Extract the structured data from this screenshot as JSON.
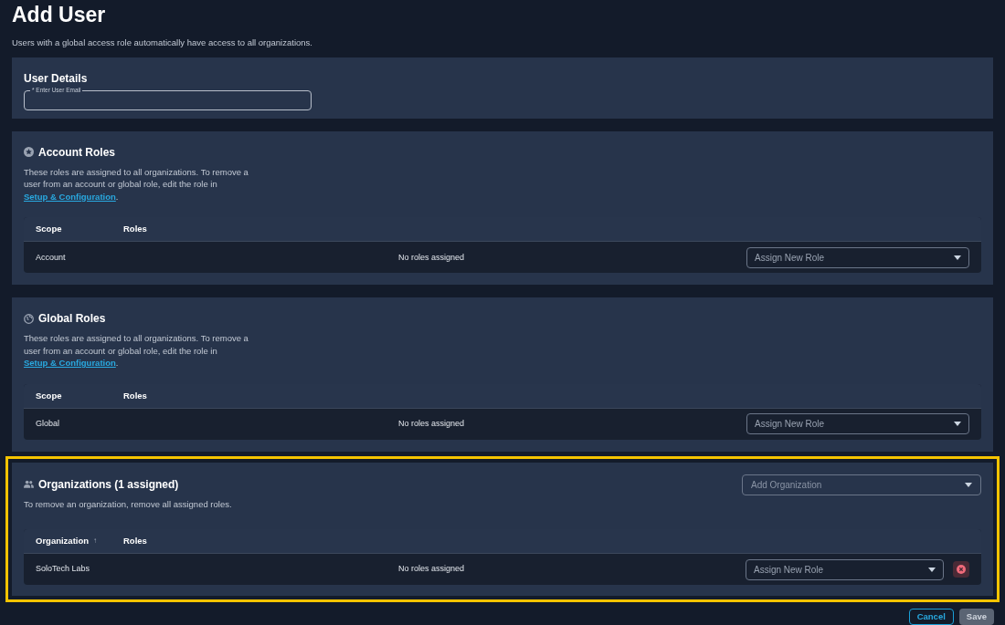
{
  "title": "Add User",
  "subtitle": "Users with a global access role automatically have access to all organizations.",
  "user_details": {
    "title": "User Details",
    "email_field": {
      "label": "* Enter User Email"
    }
  },
  "role_sections": [
    {
      "kind": "account",
      "title": "Account Roles",
      "description": "These roles are assigned to all organizations. To remove a user from an account or global role, edit the role in ",
      "link": "Setup & Configuration",
      "end": ".",
      "columns": [
        "Scope",
        "Roles"
      ],
      "rows": [
        {
          "scope": "Account",
          "roles": "No roles assigned",
          "select": "Assign New Role"
        }
      ]
    },
    {
      "kind": "global",
      "title": "Global Roles",
      "description": "These roles are assigned to all organizations. To remove a user from an account or global role, edit the role in ",
      "link": "Setup & Configuration",
      "end": ".",
      "columns": [
        "Scope",
        "Roles"
      ],
      "rows": [
        {
          "scope": "Global",
          "roles": "No roles assigned",
          "select": "Assign New Role"
        }
      ]
    }
  ],
  "organizations": {
    "title": "Organizations (1 assigned)",
    "highlighted": true,
    "description": "To remove an organization, remove all assigned roles.",
    "add_select": "Add Organization",
    "columns": [
      "Organization",
      "Roles"
    ],
    "sort_arrow": "↑",
    "rows": [
      {
        "name": "SoloTech Labs",
        "roles": "No roles assigned",
        "select": "Assign New Role"
      }
    ]
  },
  "buttons": [
    {
      "label": "Cancel",
      "kind": "outline",
      "disabled": false
    },
    {
      "label": "Save",
      "kind": "primary",
      "disabled": true
    }
  ]
}
